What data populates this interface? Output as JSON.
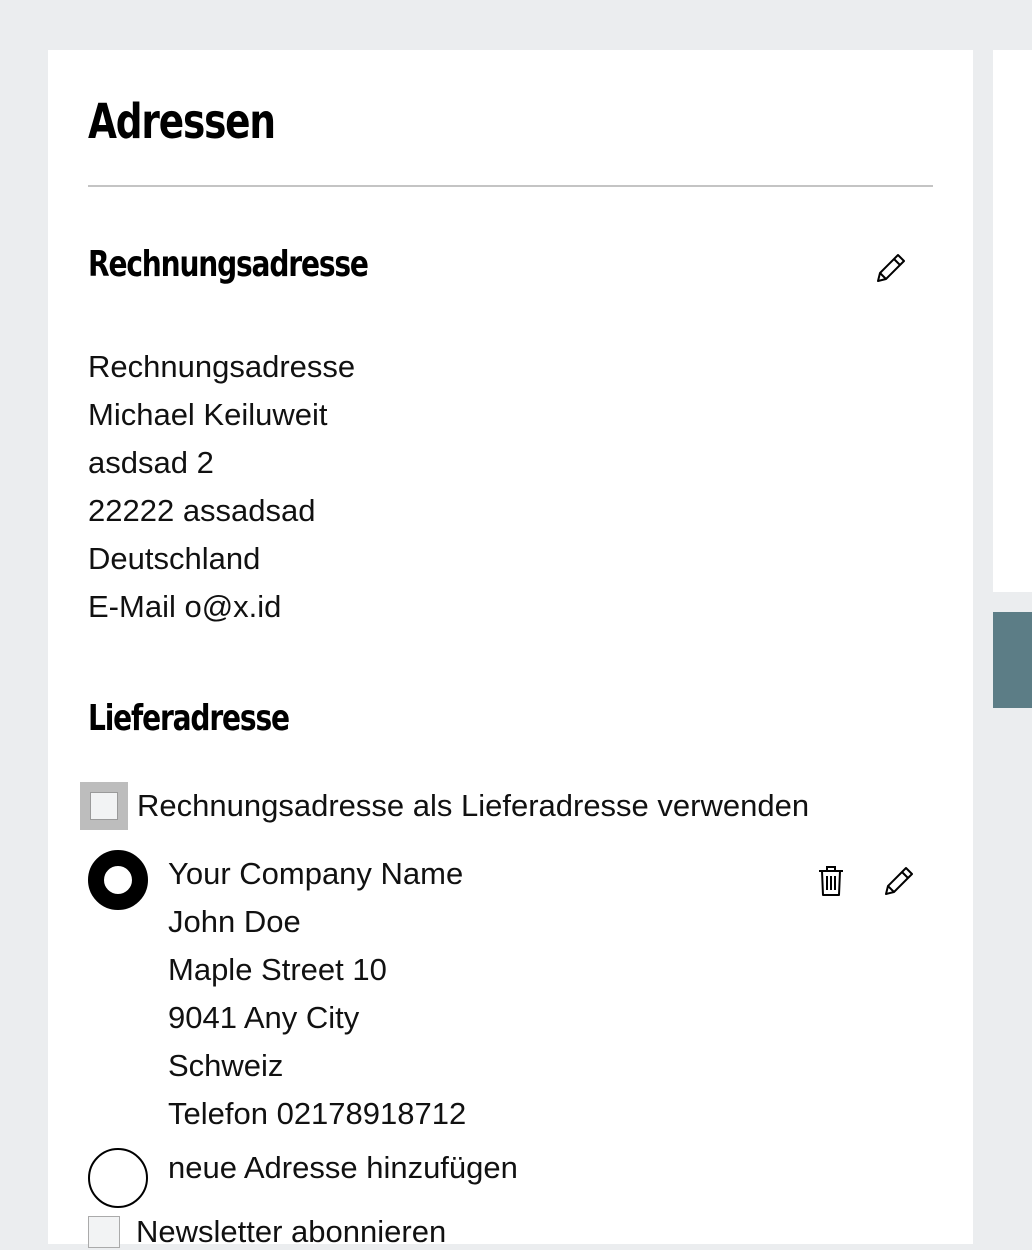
{
  "page": {
    "title": "Adressen"
  },
  "billing": {
    "heading": "Rechnungsadresse",
    "edit_icon": "pencil-icon",
    "lines": [
      "Rechnungsadresse",
      "Michael Keiluweit",
      "asdsad 2",
      "22222 assadsad",
      "Deutschland",
      "E-Mail o@x.id"
    ]
  },
  "delivery": {
    "heading": "Lieferadresse",
    "same_as_billing_label": "Rechnungsadresse als Lieferadresse verwenden",
    "same_as_billing_checked": false,
    "address": {
      "selected": true,
      "delete_icon": "trash-icon",
      "edit_icon": "pencil-icon",
      "lines": [
        "Your Company Name",
        "John Doe",
        "Maple Street 10",
        "9041 Any City",
        "Schweiz",
        "Telefon 02178918712"
      ]
    },
    "new_address_label": "neue Adresse hinzufügen",
    "new_address_selected": false
  },
  "newsletter": {
    "label": "Newsletter abonnieren",
    "checked": false
  },
  "colors": {
    "background": "#ebedef",
    "accent": "#5c7d86",
    "card": "#ffffff"
  }
}
